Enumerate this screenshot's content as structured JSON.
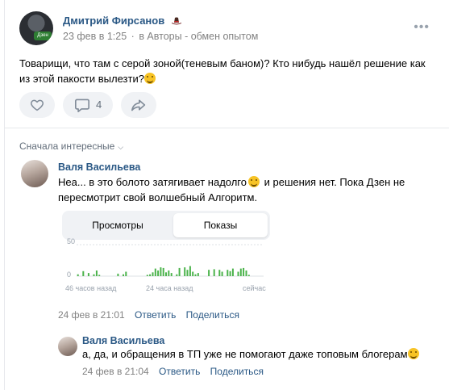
{
  "post": {
    "author": "Дмитрий Фирсанов",
    "avatar_badge": "Дзен",
    "date": "23 фев в 1:25",
    "separator": "·",
    "group": "в Авторы - обмен опытом",
    "text": "Товарищи, что там с серой зоной(теневым баном)? Кто нибудь нашёл решение как из этой пакости вылезти?",
    "actions": {
      "comments_count": "4"
    }
  },
  "comments": {
    "sort_label": "Сначала интересные",
    "first": {
      "author": "Валя Васильева",
      "text_part1": "Неа... в это болото затягивает надолго",
      "text_part2": " и решения нет. Пока Дзен не пересмотрит свой волшебный Алгоритм.",
      "date": "24 фев в 21:01",
      "reply_label": "Ответить",
      "share_label": "Поделиться",
      "stats_image": {
        "tabs": [
          "Просмотры",
          "Показы"
        ],
        "active_tab": 1,
        "y_max_label": "50",
        "y_min_label": "0",
        "x_labels": [
          "46 часов назад",
          "24 часа назад",
          "сейчас"
        ],
        "bar_color": "#4bb34b"
      }
    },
    "reply": {
      "author": "Валя Васильева",
      "text": "а, да, и обращения в ТП уже не помогают даже топовым блогерам",
      "date": "24 фев в 21:04",
      "reply_label": "Ответить",
      "share_label": "Поделиться"
    }
  },
  "chart_data": {
    "type": "bar",
    "title": "",
    "ylim": [
      0,
      50
    ],
    "x": [
      "46 часов назад",
      "24 часа назад",
      "сейчас"
    ],
    "values": [
      3,
      0,
      8,
      0,
      5,
      0,
      3,
      9,
      2,
      0,
      0,
      0,
      0,
      0,
      0,
      4,
      0,
      3,
      7,
      0,
      0,
      0,
      0,
      0,
      0,
      0,
      2,
      3,
      6,
      12,
      9,
      14,
      13,
      6,
      9,
      5,
      0,
      3,
      13,
      0,
      14,
      10,
      16,
      7,
      3,
      5,
      0,
      0,
      0,
      10,
      0,
      11,
      0,
      10,
      7,
      0,
      10,
      8,
      12,
      0,
      7,
      12,
      13,
      9,
      2,
      0,
      0,
      0,
      0,
      0
    ]
  }
}
